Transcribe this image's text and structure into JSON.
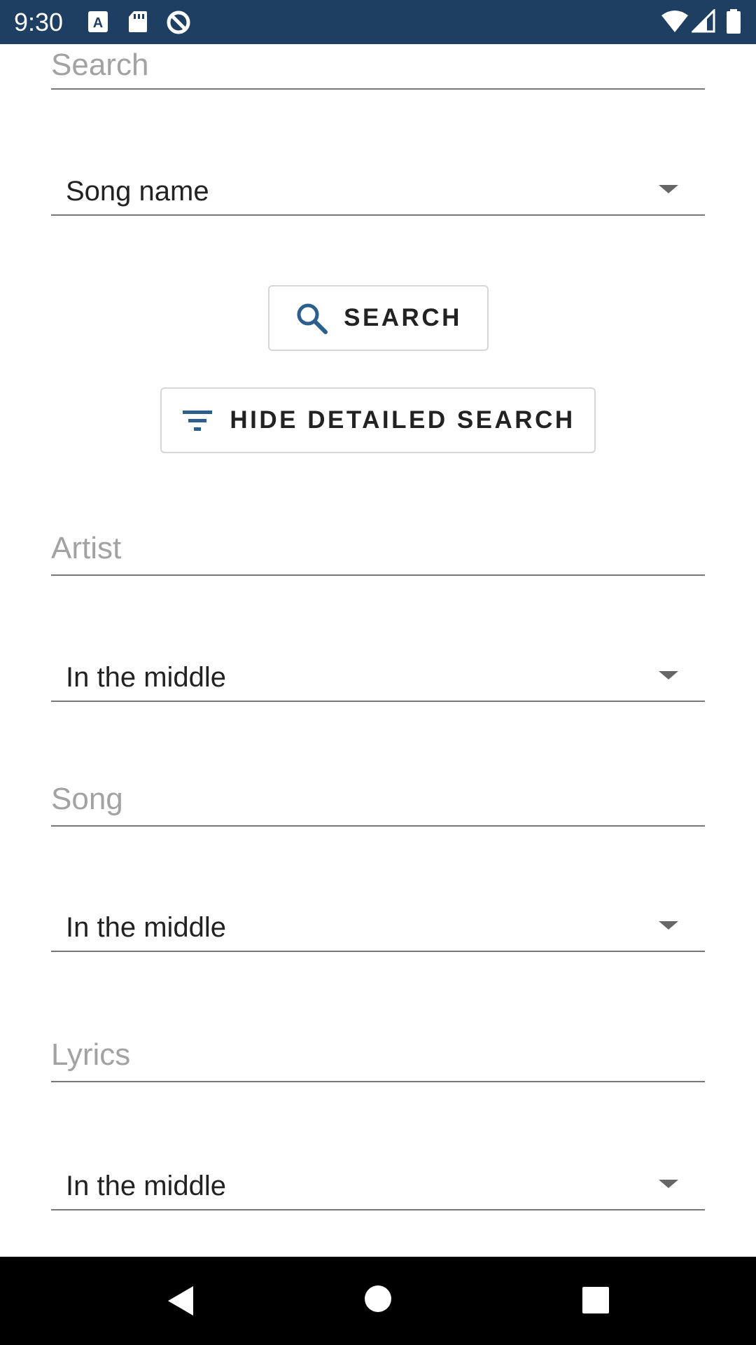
{
  "status_bar": {
    "time": "9:30",
    "icons": [
      "text-a-icon",
      "sd-card-icon",
      "no-data-sync-icon",
      "wifi-icon",
      "cell-signal-icon",
      "battery-icon"
    ],
    "background": "#1e3f62"
  },
  "search_form": {
    "search_placeholder": "Search",
    "search_by_select": "Song name",
    "search_button_label": "SEARCH",
    "toggle_detail_button_label": "HIDE DETAILED SEARCH",
    "artist_placeholder": "Artist",
    "artist_match_select": "In the middle",
    "song_placeholder": "Song",
    "song_match_select": "In the middle",
    "lyrics_placeholder": "Lyrics",
    "lyrics_match_select": "In the middle"
  },
  "colors": {
    "accent": "#2d5f8c",
    "underline": "#777777",
    "placeholder": "#a2a2a2"
  },
  "nav_bar": {
    "icons": [
      "back-icon",
      "home-icon",
      "recents-icon"
    ]
  }
}
